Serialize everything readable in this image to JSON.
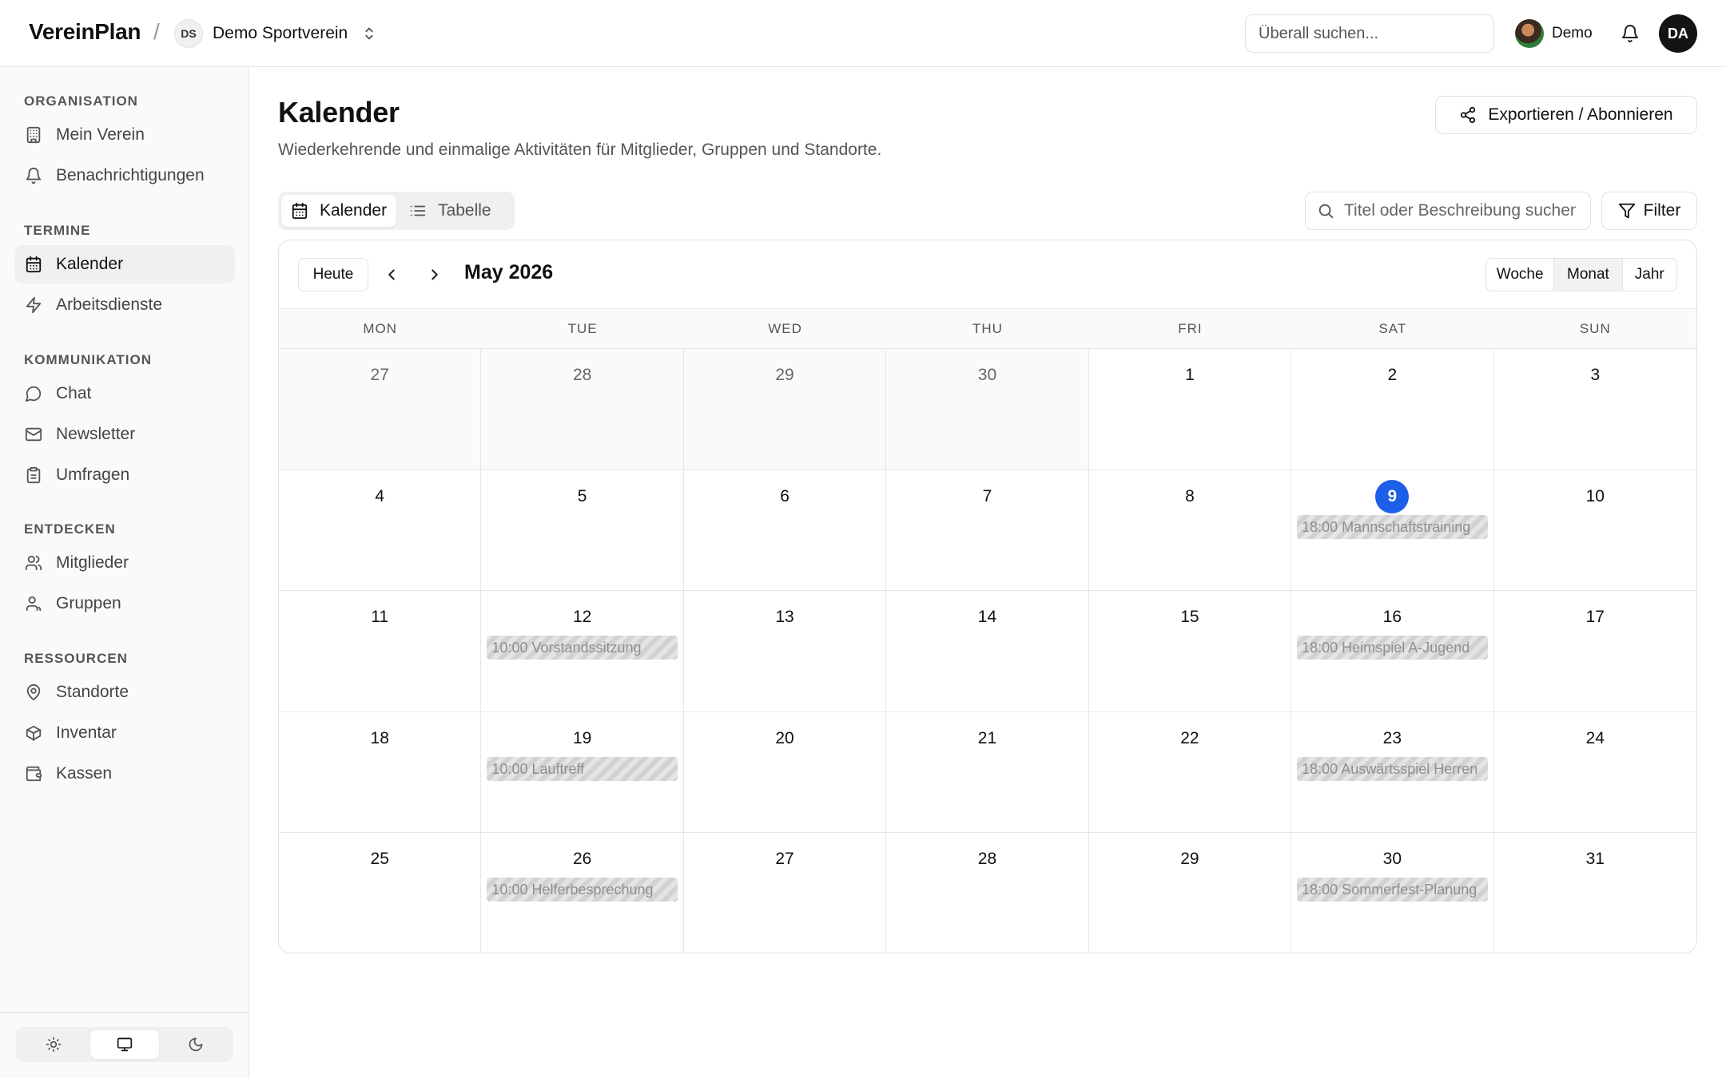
{
  "app": {
    "brand": "VereinPlan",
    "separator": "/"
  },
  "org": {
    "initials": "DS",
    "name": "Demo Sportverein"
  },
  "topbar": {
    "search_placeholder": "Überall suchen...",
    "user_name": "Demo",
    "account_initials": "DA"
  },
  "sidebar": {
    "groups": [
      {
        "heading": "ORGANISATION",
        "items": [
          {
            "label": "Mein Verein",
            "icon": "building-icon"
          },
          {
            "label": "Benachrichtigungen",
            "icon": "bell-icon"
          }
        ]
      },
      {
        "heading": "TERMINE",
        "items": [
          {
            "label": "Kalender",
            "icon": "calendar-icon",
            "active": true
          },
          {
            "label": "Arbeitsdienste",
            "icon": "lightning-icon"
          }
        ]
      },
      {
        "heading": "KOMMUNIKATION",
        "items": [
          {
            "label": "Chat",
            "icon": "chat-icon"
          },
          {
            "label": "Newsletter",
            "icon": "mail-icon"
          },
          {
            "label": "Umfragen",
            "icon": "clipboard-icon"
          }
        ]
      },
      {
        "heading": "ENTDECKEN",
        "items": [
          {
            "label": "Mitglieder",
            "icon": "user-icon"
          },
          {
            "label": "Gruppen",
            "icon": "users-icon"
          }
        ]
      },
      {
        "heading": "RESSOURCEN",
        "items": [
          {
            "label": "Standorte",
            "icon": "map-pin-icon"
          },
          {
            "label": "Inventar",
            "icon": "box-icon"
          },
          {
            "label": "Kassen",
            "icon": "wallet-icon"
          }
        ]
      }
    ],
    "theme": {
      "options": [
        "light",
        "system",
        "dark"
      ],
      "selected": "system"
    }
  },
  "page": {
    "title": "Kalender",
    "subtitle": "Wiederkehrende und einmalige Aktivitäten für Mitglieder, Gruppen und Standorte.",
    "export_label": "Exportieren / Abonnieren"
  },
  "view_tabs": [
    {
      "label": "Kalender",
      "icon": "calendar-icon",
      "active": true
    },
    {
      "label": "Tabelle",
      "icon": "list-icon",
      "active": false
    }
  ],
  "event_search": {
    "placeholder": "Titel oder Beschreibung suchen"
  },
  "filter_label": "Filter",
  "calendar": {
    "today_label": "Heute",
    "month_label": "May 2026",
    "ranges": [
      {
        "label": "Woche",
        "active": false
      },
      {
        "label": "Monat",
        "active": true
      },
      {
        "label": "Jahr",
        "active": false
      }
    ],
    "weekdays": [
      "MON",
      "TUE",
      "WED",
      "THU",
      "FRI",
      "SAT",
      "SUN"
    ],
    "days": [
      {
        "num": "27",
        "outside": true
      },
      {
        "num": "28",
        "outside": true
      },
      {
        "num": "29",
        "outside": true
      },
      {
        "num": "30",
        "outside": true
      },
      {
        "num": "1"
      },
      {
        "num": "2"
      },
      {
        "num": "3"
      },
      {
        "num": "4"
      },
      {
        "num": "5"
      },
      {
        "num": "6"
      },
      {
        "num": "7"
      },
      {
        "num": "8"
      },
      {
        "num": "9",
        "today": true,
        "event": "18:00 Mannschaftstraining"
      },
      {
        "num": "10"
      },
      {
        "num": "11"
      },
      {
        "num": "12",
        "event": "10:00 Vorstandssitzung"
      },
      {
        "num": "13"
      },
      {
        "num": "14"
      },
      {
        "num": "15"
      },
      {
        "num": "16",
        "event": "18:00 Heimspiel A-Jugend"
      },
      {
        "num": "17"
      },
      {
        "num": "18"
      },
      {
        "num": "19",
        "event": "10:00 Lauftreff"
      },
      {
        "num": "20"
      },
      {
        "num": "21"
      },
      {
        "num": "22"
      },
      {
        "num": "23",
        "event": "18:00 Auswärtsspiel Herren"
      },
      {
        "num": "24"
      },
      {
        "num": "25"
      },
      {
        "num": "26",
        "event": "10:00 Helferbesprechung"
      },
      {
        "num": "27"
      },
      {
        "num": "28"
      },
      {
        "num": "29"
      },
      {
        "num": "30",
        "event": "18:00 Sommerfest-Planung"
      },
      {
        "num": "31"
      }
    ]
  },
  "colors": {
    "accent": "#1c5fe8",
    "text": "#111111",
    "muted": "#555555",
    "border": "#e6e6e6"
  }
}
